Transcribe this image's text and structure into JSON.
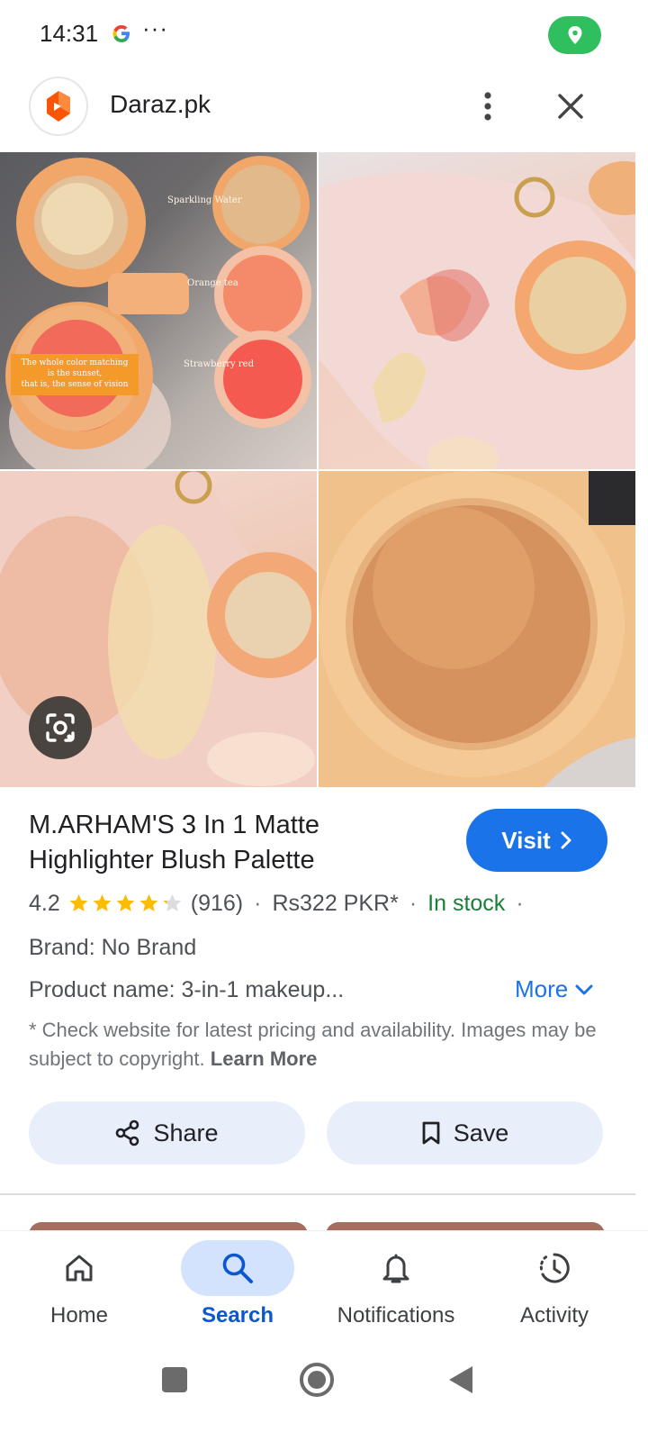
{
  "status_bar": {
    "time": "14:31",
    "overflow": "···",
    "icons": [
      "google-icon",
      "location-icon"
    ],
    "location_pill_color": "#2fbf5f"
  },
  "app_bar": {
    "site_name": "Daraz.pk",
    "logo_icon": "daraz-logo",
    "menu_icon": "more-vert-icon",
    "close_icon": "close-icon"
  },
  "images": {
    "tile1_captions": [
      "Sparkling Water",
      "Orange tea",
      "Strawberry red"
    ],
    "tile1_banner": [
      "The whole color matching",
      "is the sunset,",
      "that is, the sense of vision"
    ],
    "lens_icon": "lens-icon"
  },
  "product": {
    "title": "M.ARHAM'S 3 In 1 Matte Highlighter Blush Palette",
    "visit_label": "Visit",
    "rating": "4.2",
    "rating_value": 4.2,
    "rating_max": 5,
    "reviews": "(916)",
    "price": "Rs322 PKR*",
    "stock": "In stock",
    "separator": "·",
    "brand": "Brand: No Brand",
    "product_name": "Product name: 3-in-1 makeup...",
    "more_label": "More",
    "disclaimer": "* Check website for latest pricing and availability. Images may be subject to copyright.",
    "learn_more": "Learn More"
  },
  "actions": {
    "share_label": "Share",
    "save_label": "Save"
  },
  "bottom_nav": {
    "items": [
      {
        "label": "Home",
        "icon": "home-icon"
      },
      {
        "label": "Search",
        "icon": "search-icon",
        "active": true
      },
      {
        "label": "Notifications",
        "icon": "bell-icon"
      },
      {
        "label": "Activity",
        "icon": "activity-icon"
      }
    ]
  },
  "system_nav": {
    "buttons": [
      "recents-button",
      "home-button",
      "back-button"
    ]
  },
  "colors": {
    "accent": "#1a73e8",
    "in_stock": "#188038",
    "star": "#fbbc04",
    "active_nav_bg": "#d3e3fd"
  }
}
